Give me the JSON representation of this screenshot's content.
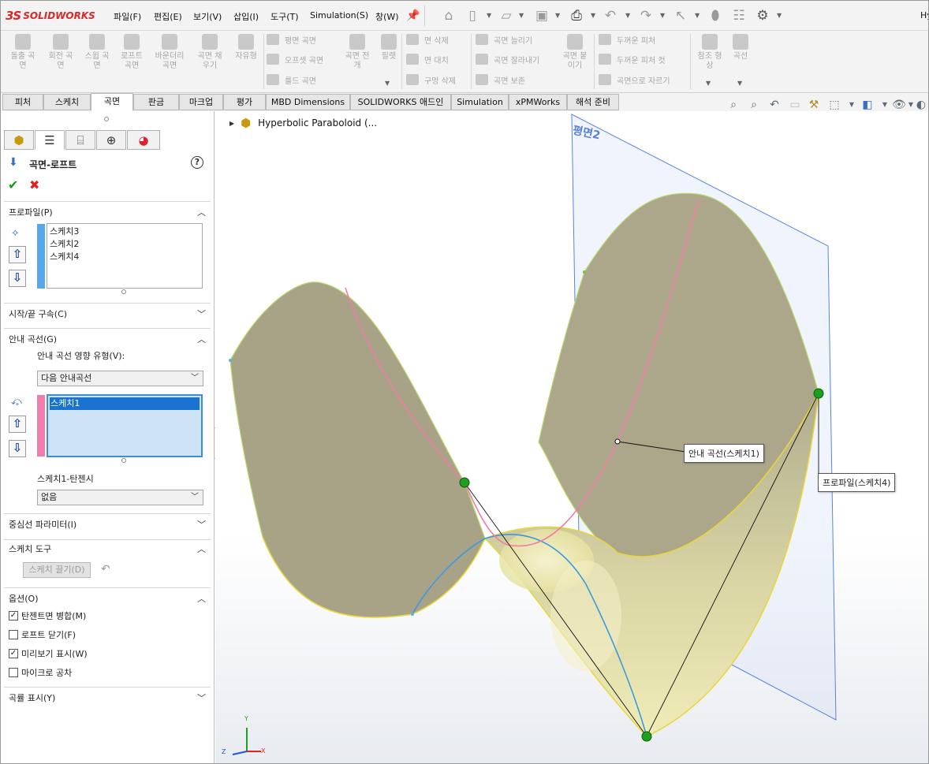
{
  "app": {
    "brand": "SOLIDWORKS",
    "title_fragment": "Hy"
  },
  "menu": [
    "파일(F)",
    "편집(E)",
    "보기(V)",
    "삽입(I)",
    "도구(T)",
    "Simulation(S)",
    "창(W)"
  ],
  "quick_toolbar_icons": [
    "home-icon",
    "new-document-icon",
    "open-icon",
    "save-icon",
    "print-icon",
    "undo-icon",
    "redo-icon",
    "select-icon",
    "rebuild-icon",
    "file-properties-icon",
    "options-icon"
  ],
  "ribbon": {
    "big_left": [
      {
        "label": "돌출 곡\n면",
        "icon": "extruded-surface-icon"
      },
      {
        "label": "회전 곡\n면",
        "icon": "revolved-surface-icon"
      },
      {
        "label": "스윕 곡\n면",
        "icon": "swept-surface-icon"
      },
      {
        "label": "로프트\n곡면",
        "icon": "lofted-surface-icon"
      },
      {
        "label": "바운더리\n곡면",
        "icon": "boundary-surface-icon"
      },
      {
        "label": "곡면 채\n우기",
        "icon": "filled-surface-icon"
      },
      {
        "label": "자유형",
        "icon": "freeform-icon"
      }
    ],
    "group2_small": [
      "평면 곡면",
      "오프셋 곡면",
      "룰드 곡면"
    ],
    "group2_big": [
      {
        "label": "곡면 전\n개",
        "icon": "surface-flatten-icon"
      },
      {
        "label": "필렛",
        "icon": "fillet-icon"
      }
    ],
    "group3_small": [
      "면 삭제",
      "면 대치",
      "구멍 삭제"
    ],
    "group4_small": [
      "곡면 늘리기",
      "곡면 잘라내기",
      "곡면 보존"
    ],
    "group4_big": {
      "label": "곡면 붙\n이기",
      "icon": "knit-surface-icon"
    },
    "group5_small": [
      "두꺼운 피처",
      "두꺼운 피처 컷",
      "곡면으로 자르기"
    ],
    "group6_big": [
      {
        "label": "참조 형\n상",
        "icon": "reference-geometry-icon"
      },
      {
        "label": "곡선",
        "icon": "curves-icon"
      }
    ]
  },
  "tabs": [
    "피처",
    "스케치",
    "곡면",
    "판금",
    "마크업",
    "평가",
    "MBD Dimensions",
    "SOLIDWORKS 애드인",
    "Simulation",
    "xPMWorks",
    "해석 준비"
  ],
  "active_tab": "곡면",
  "property_manager": {
    "title": "곡면-로프트",
    "sections": {
      "profiles": {
        "title": "프로파일(P)",
        "items": [
          "스케치3",
          "스케치2",
          "스케치4"
        ]
      },
      "start_end": {
        "title": "시작/끝 구속(C)"
      },
      "guides": {
        "title": "안내 곡선(G)",
        "influence_label": "안내 곡선 영향 유형(V):",
        "influence_value": "다음 안내곡선",
        "items": [
          "스케치1"
        ],
        "tangency_label": "스케치1-탄젠시",
        "tangency_value": "없음"
      },
      "centerline": {
        "title": "중심선 파라미터(I)"
      },
      "sketch_tools": {
        "title": "스케치 도구",
        "button": "스케치 끌기(D)"
      },
      "options": {
        "title": "옵션(O)",
        "checkboxes": [
          {
            "label": "탄젠트면 병합(M)",
            "checked": true
          },
          {
            "label": "로프트 닫기(F)",
            "checked": false
          },
          {
            "label": "미리보기 표시(W)",
            "checked": true
          },
          {
            "label": "마이크로 공차",
            "checked": false
          }
        ]
      },
      "curvature": {
        "title": "곡률 표시(Y)"
      }
    }
  },
  "viewport": {
    "tree_root": "Hyperbolic Paraboloid (...",
    "plane_label": "평면2",
    "callout_guide": "안내 곡선(스케치1)",
    "callout_profile": "프로파일(스케치4)",
    "triad": {
      "x": "X",
      "y": "Y",
      "z": "Z"
    }
  },
  "colors": {
    "accent_blue": "#3b8fd9",
    "guide_pink": "#e8739a",
    "surface_tan": "#a9a487",
    "surface_yellow": "#e9e5a8",
    "point_green": "#1ea01e",
    "plane_blue": "#4f7de0"
  }
}
